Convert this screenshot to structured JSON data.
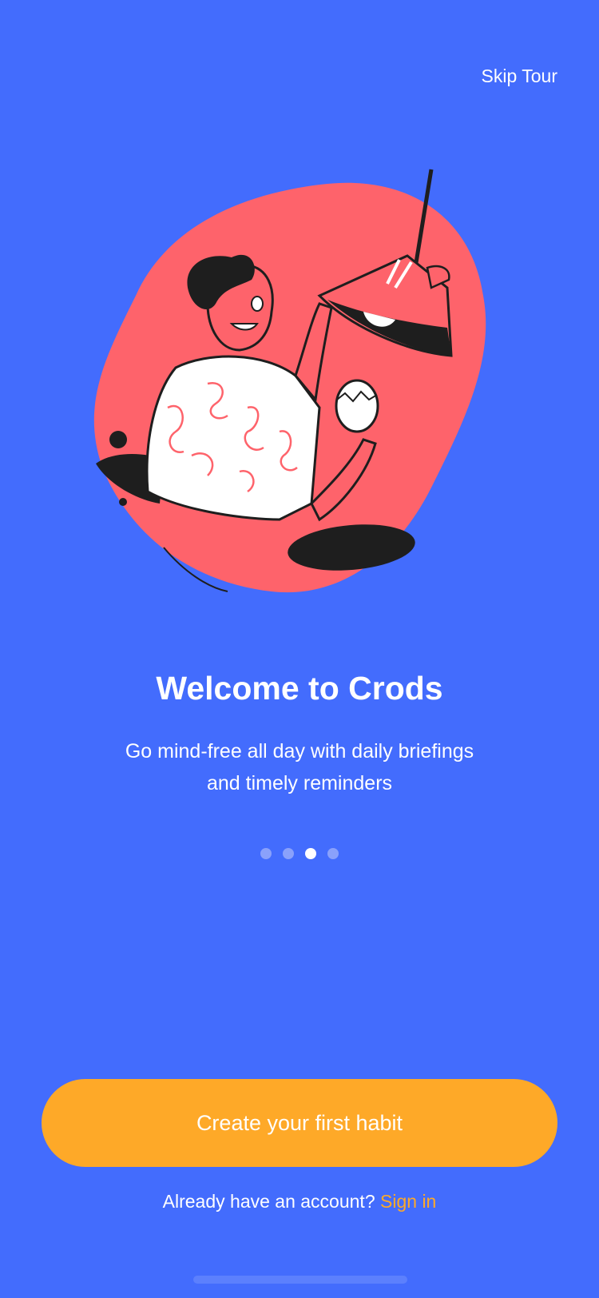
{
  "header": {
    "skip_label": "Skip Tour"
  },
  "onboarding": {
    "title": "Welcome to Crods",
    "subtitle_line1": "Go mind-free all day with daily briefings",
    "subtitle_line2": "and timely reminders",
    "page_count": 4,
    "active_page": 3
  },
  "actions": {
    "cta_label": "Create your first habit",
    "signin_prompt": "Already have an account? ",
    "signin_link": "Sign in"
  },
  "colors": {
    "background": "#436cfd",
    "blob": "#fe636b",
    "accent": "#fea928",
    "ink": "#1e1e1e",
    "white": "#ffffff"
  }
}
